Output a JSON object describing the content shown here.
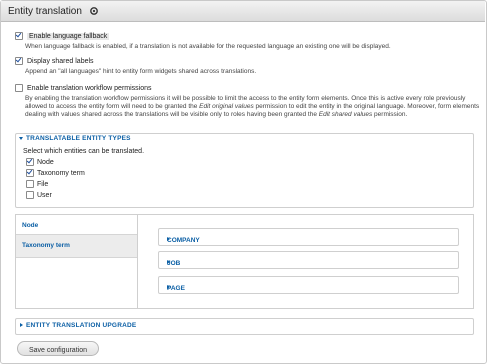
{
  "header": {
    "title": "Entity translation",
    "gear_icon": "gear-icon"
  },
  "options": {
    "fallback": {
      "label": "Enable language fallback",
      "checked": true,
      "description": "When language fallback is enabled, if a translation is not available for the requested language an existing one will be displayed."
    },
    "shared_labels": {
      "label": "Display shared labels",
      "checked": true,
      "description": "Append an \"all languages\" hint to entity form widgets shared across translations."
    },
    "workflow": {
      "label": "Enable translation workflow permissions",
      "checked": false,
      "description_1": "By enabling the translation workflow permissions it will be possible to limit the access to the entity form elements. Once this is active every role previously allowed to access the entity form will need to be granted the ",
      "em_1": "Edit original values",
      "description_2": " permission to edit the entity in the original language. Moreover, form elements dealing with values shared across the translations will be visible only to roles having been granted the ",
      "em_2": "Edit shared values",
      "description_3": " permission."
    }
  },
  "entity_types": {
    "legend": "TRANSLATABLE ENTITY TYPES",
    "intro": "Select which entities can be translated.",
    "items": [
      {
        "label": "Node",
        "checked": true
      },
      {
        "label": "Taxonomy term",
        "checked": true
      },
      {
        "label": "File",
        "checked": false
      },
      {
        "label": "User",
        "checked": false
      }
    ]
  },
  "vertical_tabs": {
    "tabs": [
      {
        "label": "Node",
        "active": true
      },
      {
        "label": "Taxonomy term",
        "active": false
      }
    ],
    "panes": [
      {
        "label": "COMPANY"
      },
      {
        "label": "JOB"
      },
      {
        "label": "PAGE"
      }
    ]
  },
  "upgrade": {
    "legend": "ENTITY TRANSLATION UPGRADE"
  },
  "actions": {
    "save_label": "Save configuration"
  },
  "colors": {
    "link": "#0b5fa5",
    "header_top": "#f3f3f3",
    "header_bottom": "#dcdcdc"
  }
}
